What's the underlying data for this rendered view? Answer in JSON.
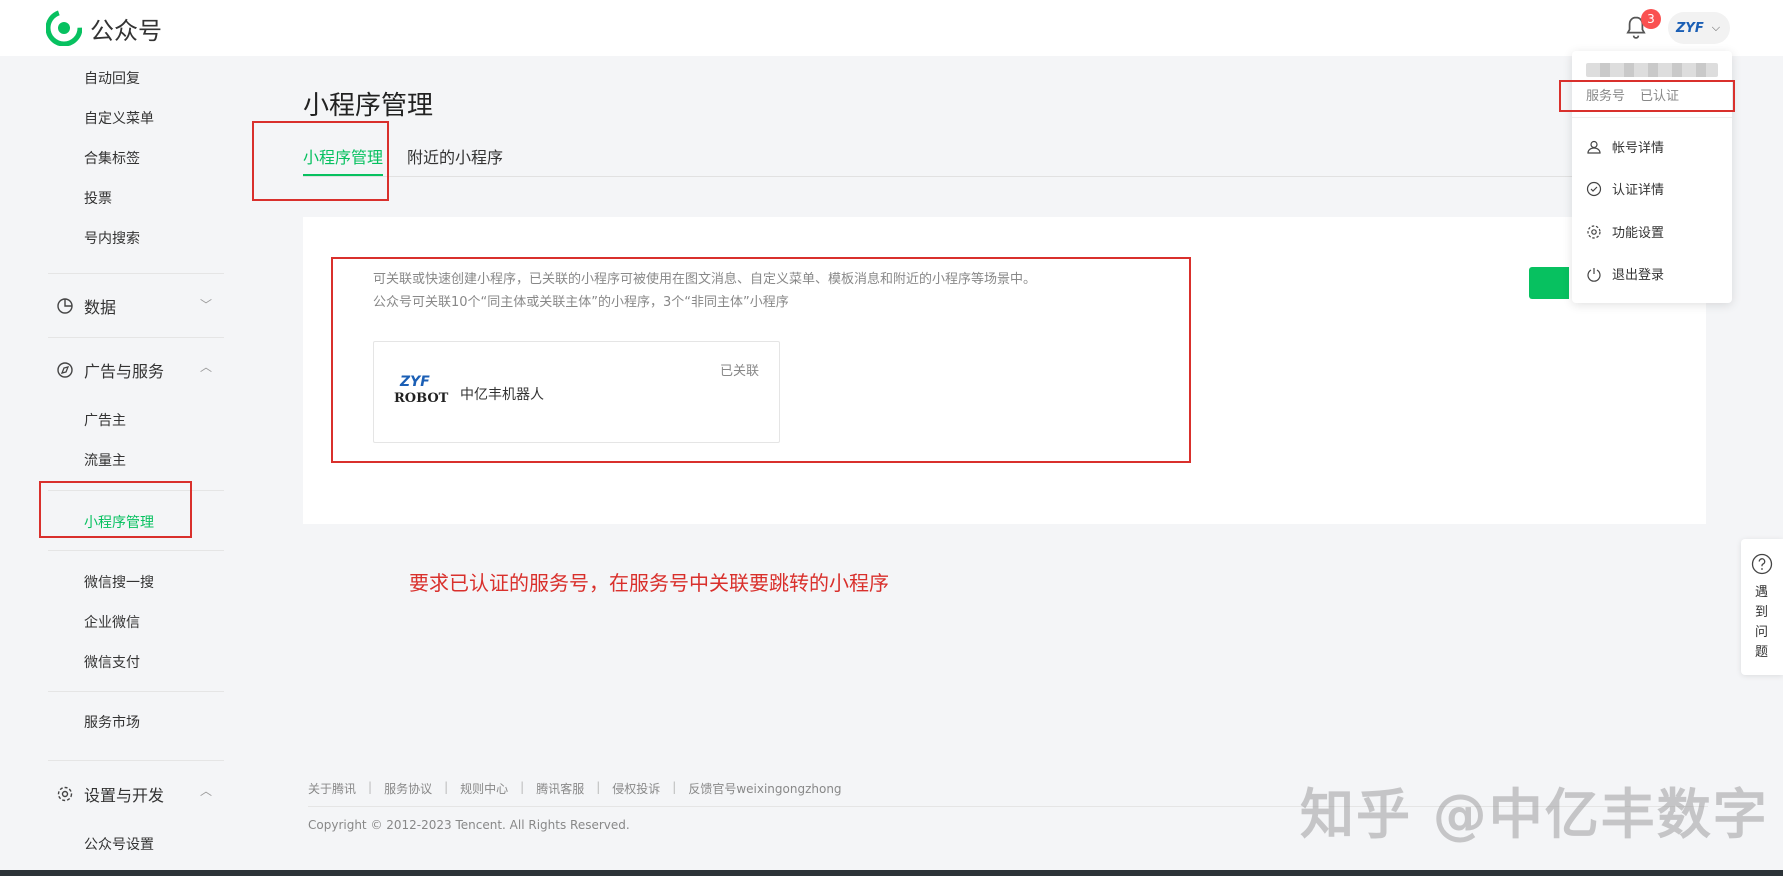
{
  "header": {
    "app_title": "公众号",
    "notification_count": "3",
    "avatar_text": "ZYF"
  },
  "sidebar": {
    "items_top": [
      "自动回复",
      "自定义菜单",
      "合集标签",
      "投票",
      "号内搜索"
    ],
    "group_data": "数据",
    "group_ads": "广告与服务",
    "ads_items": [
      "广告主",
      "流量主"
    ],
    "active_item": "小程序管理",
    "service_items": [
      "微信搜一搜",
      "企业微信",
      "微信支付"
    ],
    "market_item": "服务市场",
    "group_settings": "设置与开发",
    "settings_items": [
      "公众号设置"
    ]
  },
  "main": {
    "page_title": "小程序管理",
    "tabs": [
      {
        "label": "小程序管理",
        "active": true
      },
      {
        "label": "附近的小程序",
        "active": false
      }
    ],
    "description_line1": "可关联或快速创建小程序，已关联的小程序可被使用在图文消息、自定义菜单、模板消息和附近的小程序等场景中。",
    "description_line2": "公众号可关联10个“同主体或关联主体”的小程序，3个“非同主体”小程序",
    "miniprogram": {
      "logo_line1": "ZYF",
      "logo_line2": "ROBOT",
      "name": "中亿丰机器人",
      "status": "已关联"
    }
  },
  "annotation": "要求已认证的服务号，在服务号中关联要跳转的小程序",
  "dropdown": {
    "account_type": "服务号",
    "verify_status": "已认证",
    "items": [
      "帐号详情",
      "认证详情",
      "功能设置",
      "退出登录"
    ]
  },
  "help": {
    "label": "遇到问题"
  },
  "footer": {
    "links": [
      "关于腾讯",
      "服务协议",
      "规则中心",
      "腾讯客服",
      "侵权投诉",
      "反馈官号weixingongzhong"
    ],
    "copyright": "Copyright © 2012-2023 Tencent. All Rights Reserved."
  },
  "watermark": "知乎 @中亿丰数字",
  "colors": {
    "brand_green": "#07c160",
    "annotation_red": "#d9302c",
    "badge_red": "#fa5151"
  }
}
